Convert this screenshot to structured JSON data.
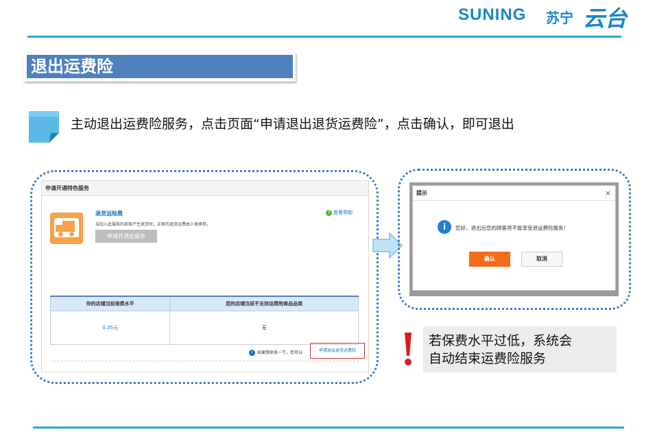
{
  "header": {
    "logo_en": "SUNING",
    "logo_cn": "苏宁",
    "logo_yuntai": "云台"
  },
  "title": "退出运费险",
  "description": "主动退出运费险服务，点击页面“申请退出退货运费险”，点击确认，即可退出",
  "left_panel": {
    "header": "申请开通特色服务",
    "service_name": "退货运险费",
    "service_desc": "当加入此服务的卖家产生退货时，买家的退货运费由人保承担。",
    "open_button": "申请开通此服务",
    "help_label": "查看帮助",
    "table": {
      "columns": [
        "你的店铺当前保费水平",
        "您的店铺当前不支持运费险商品品类"
      ],
      "row": [
        "0.35元",
        "无"
      ]
    },
    "exit_note": "如果想休息一下，您可以",
    "exit_link": "申请退出退货运费险"
  },
  "dialog": {
    "title": "提示",
    "close_glyph": "×",
    "info_glyph": "i",
    "message": "您好，退出后您的顾客将不能享受退运费险服务！",
    "confirm_button": "确认",
    "cancel_button": "取消"
  },
  "warning": {
    "line1": "若保费水平过低，系统会",
    "line2": "自动结束运费险服务"
  },
  "colors": {
    "accent": "#2aa6db",
    "title_bg": "#4f81bd",
    "confirm": "#f26c1b",
    "warning_red": "#d81e1e"
  }
}
